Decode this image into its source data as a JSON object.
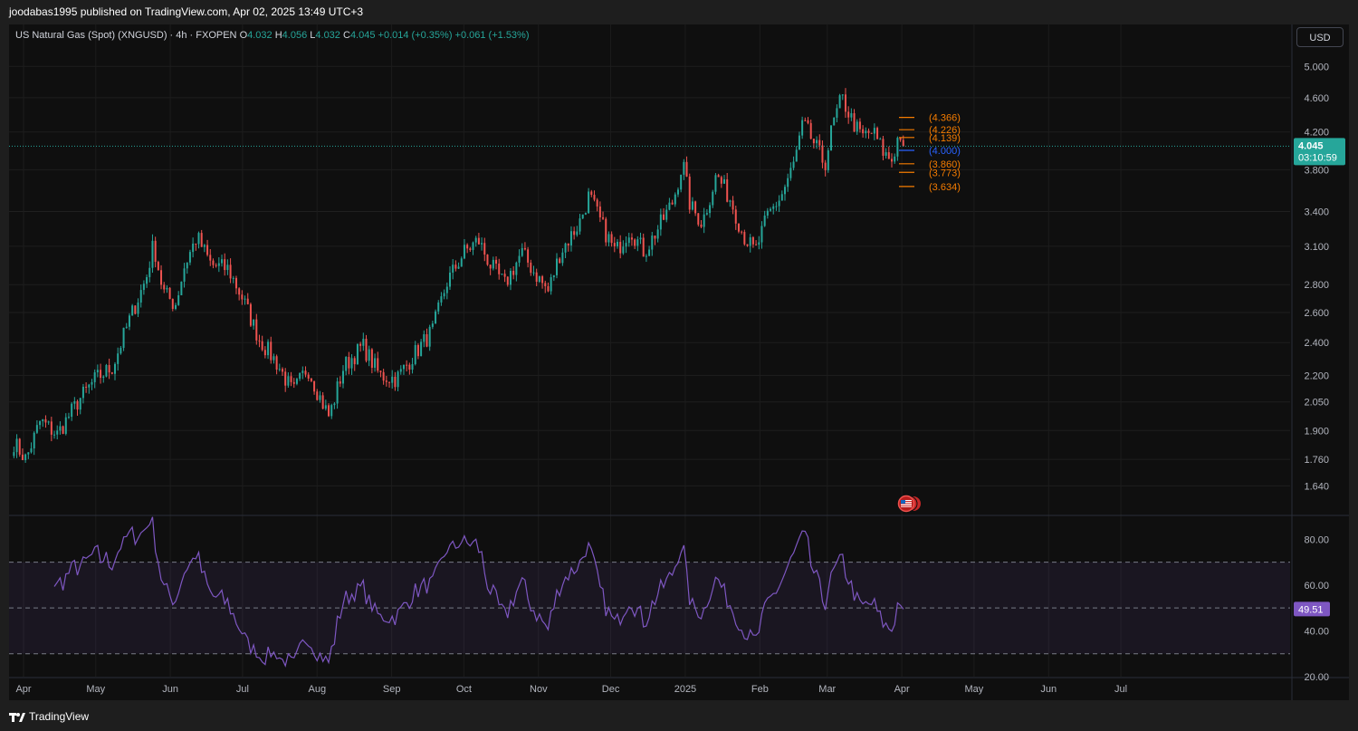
{
  "header": {
    "publisher_line": "joodabas1995 published on TradingView.com, Apr 02, 2025 13:49 UTC+3"
  },
  "legend": {
    "symbol": "US Natural Gas (Spot) (XNGUSD) · 4h · FXOPEN",
    "o_label": "O",
    "o_value": "4.032",
    "h_label": "H",
    "h_value": "4.056",
    "l_label": "L",
    "l_value": "4.032",
    "c_label": "C",
    "c_value": "4.045",
    "change": "+0.014 (+0.35%)",
    "change2": "+0.061 (+1.53%)"
  },
  "currency_button": "USD",
  "price_badge": {
    "price": "4.045",
    "countdown": "03:10:59"
  },
  "rsi_badge": "49.51",
  "footer": {
    "brand": "TradingView"
  },
  "colors": {
    "up": "#26a69a",
    "down": "#ef5350",
    "background": "#0f0f0f",
    "rsi": "#7e57c2",
    "levels": "#f57c00",
    "pivot": "#2962ff"
  },
  "chart_data": [
    {
      "type": "candlestick",
      "title": "US Natural Gas (Spot) (XNGUSD)",
      "interval": "4h",
      "scale": "log",
      "ylim": [
        1.52,
        5.2
      ],
      "y_ticks": [
        "5.000",
        "4.600",
        "4.200",
        "3.800",
        "3.400",
        "3.100",
        "2.800",
        "2.600",
        "2.400",
        "2.200",
        "2.050",
        "1.900",
        "1.760",
        "1.640"
      ],
      "x_ticks": [
        "Apr",
        "May",
        "Jun",
        "Jul",
        "Aug",
        "Sep",
        "Oct",
        "Nov",
        "Dec",
        "2025",
        "Feb",
        "Mar",
        "Apr",
        "May",
        "Jun",
        "Jul"
      ],
      "grid": true,
      "last_price": 4.045,
      "path": [
        [
          "2024-03-28",
          1.84
        ],
        [
          "2024-04-02",
          1.76
        ],
        [
          "2024-04-08",
          1.95
        ],
        [
          "2024-04-15",
          1.88
        ],
        [
          "2024-04-24",
          2.06
        ],
        [
          "2024-05-01",
          2.18
        ],
        [
          "2024-05-08",
          2.25
        ],
        [
          "2024-05-15",
          2.55
        ],
        [
          "2024-05-22",
          2.85
        ],
        [
          "2024-05-25",
          3.12
        ],
        [
          "2024-05-29",
          2.75
        ],
        [
          "2024-06-03",
          2.65
        ],
        [
          "2024-06-07",
          2.95
        ],
        [
          "2024-06-12",
          3.18
        ],
        [
          "2024-06-18",
          2.95
        ],
        [
          "2024-06-25",
          2.92
        ],
        [
          "2024-07-01",
          2.7
        ],
        [
          "2024-07-08",
          2.42
        ],
        [
          "2024-07-15",
          2.28
        ],
        [
          "2024-07-22",
          2.1
        ],
        [
          "2024-07-28",
          2.25
        ],
        [
          "2024-08-02",
          2.08
        ],
        [
          "2024-08-06",
          1.97
        ],
        [
          "2024-08-12",
          2.25
        ],
        [
          "2024-08-20",
          2.38
        ],
        [
          "2024-08-27",
          2.2
        ],
        [
          "2024-09-03",
          2.18
        ],
        [
          "2024-09-10",
          2.32
        ],
        [
          "2024-09-18",
          2.48
        ],
        [
          "2024-09-24",
          2.82
        ],
        [
          "2024-10-01",
          3.05
        ],
        [
          "2024-10-07",
          3.15
        ],
        [
          "2024-10-12",
          2.95
        ],
        [
          "2024-10-18",
          2.8
        ],
        [
          "2024-10-25",
          3.05
        ],
        [
          "2024-10-30",
          2.9
        ],
        [
          "2024-11-05",
          2.75
        ],
        [
          "2024-11-10",
          3.05
        ],
        [
          "2024-11-18",
          3.3
        ],
        [
          "2024-11-22",
          3.55
        ],
        [
          "2024-11-28",
          3.25
        ],
        [
          "2024-12-03",
          3.05
        ],
        [
          "2024-12-09",
          3.25
        ],
        [
          "2024-12-15",
          3.05
        ],
        [
          "2024-12-22",
          3.3
        ],
        [
          "2024-12-27",
          3.5
        ],
        [
          "2024-12-31",
          3.88
        ],
        [
          "2025-01-03",
          3.45
        ],
        [
          "2025-01-08",
          3.3
        ],
        [
          "2025-01-14",
          3.75
        ],
        [
          "2025-01-20",
          3.5
        ],
        [
          "2025-01-25",
          3.2
        ],
        [
          "2025-01-30",
          3.05
        ],
        [
          "2025-02-04",
          3.35
        ],
        [
          "2025-02-10",
          3.55
        ],
        [
          "2025-02-15",
          3.85
        ],
        [
          "2025-02-19",
          4.3
        ],
        [
          "2025-02-24",
          4.05
        ],
        [
          "2025-02-28",
          3.85
        ],
        [
          "2025-03-03",
          4.25
        ],
        [
          "2025-03-07",
          4.6
        ],
        [
          "2025-03-11",
          4.35
        ],
        [
          "2025-03-15",
          4.15
        ],
        [
          "2025-03-20",
          4.2
        ],
        [
          "2025-03-25",
          3.95
        ],
        [
          "2025-03-28",
          3.9
        ],
        [
          "2025-03-31",
          4.2
        ],
        [
          "2025-04-02",
          4.045
        ]
      ]
    },
    {
      "type": "line",
      "title": "RSI",
      "ylim": [
        20,
        90
      ],
      "y_ticks": [
        "80.00",
        "60.00",
        "40.00",
        "20.00"
      ],
      "bands": [
        30,
        50,
        70
      ],
      "last_value": 49.51,
      "x_range": [
        "2024-03-28",
        "2025-04-02"
      ]
    }
  ],
  "levels": [
    {
      "label": "(4.366)",
      "value": 4.366
    },
    {
      "label": "(4.226)",
      "value": 4.226
    },
    {
      "label": "(4.139)",
      "value": 4.139
    },
    {
      "label": "(4.000)",
      "value": 4.0,
      "pivot": true
    },
    {
      "label": "(3.860)",
      "value": 3.86
    },
    {
      "label": "(3.773)",
      "value": 3.773
    },
    {
      "label": "(3.634)",
      "value": 3.634
    }
  ]
}
